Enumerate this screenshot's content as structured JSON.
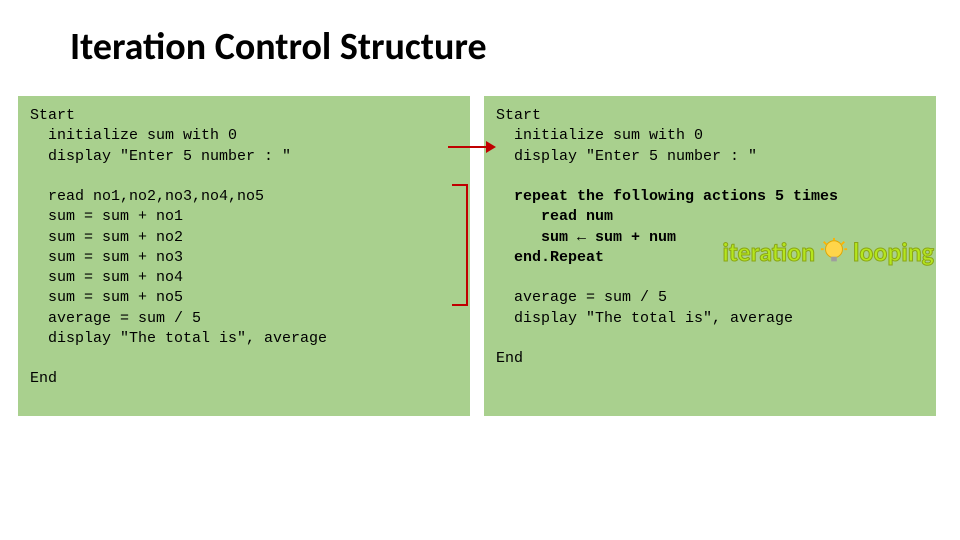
{
  "title": "Iteration Control Structure",
  "left": {
    "l1": "Start",
    "l2": "  initialize sum with 0",
    "l3": "  display \"Enter 5 number : \"",
    "l4": "  read no1,no2,no3,no4,no5",
    "l5": "  sum = sum + no1",
    "l6": "  sum = sum + no2",
    "l7": "  sum = sum + no3",
    "l8": "  sum = sum + no4",
    "l9": "  sum = sum + no5",
    "l10": "  average = sum / 5",
    "l11": "  display \"The total is\", average",
    "l12": "End"
  },
  "right": {
    "r1": "Start",
    "r2": "  initialize sum with 0",
    "r3": "  display \"Enter 5 number : \"",
    "r4": "  repeat the following actions 5 times",
    "r5": "     read num",
    "r6": "     sum ← sum + num",
    "r7": "  end.Repeat",
    "r8": "  average = sum / 5",
    "r9": "  display \"The total is\", average",
    "r10": "End"
  },
  "badge": {
    "left": "iteration",
    "sep": "/",
    "right": "looping"
  }
}
